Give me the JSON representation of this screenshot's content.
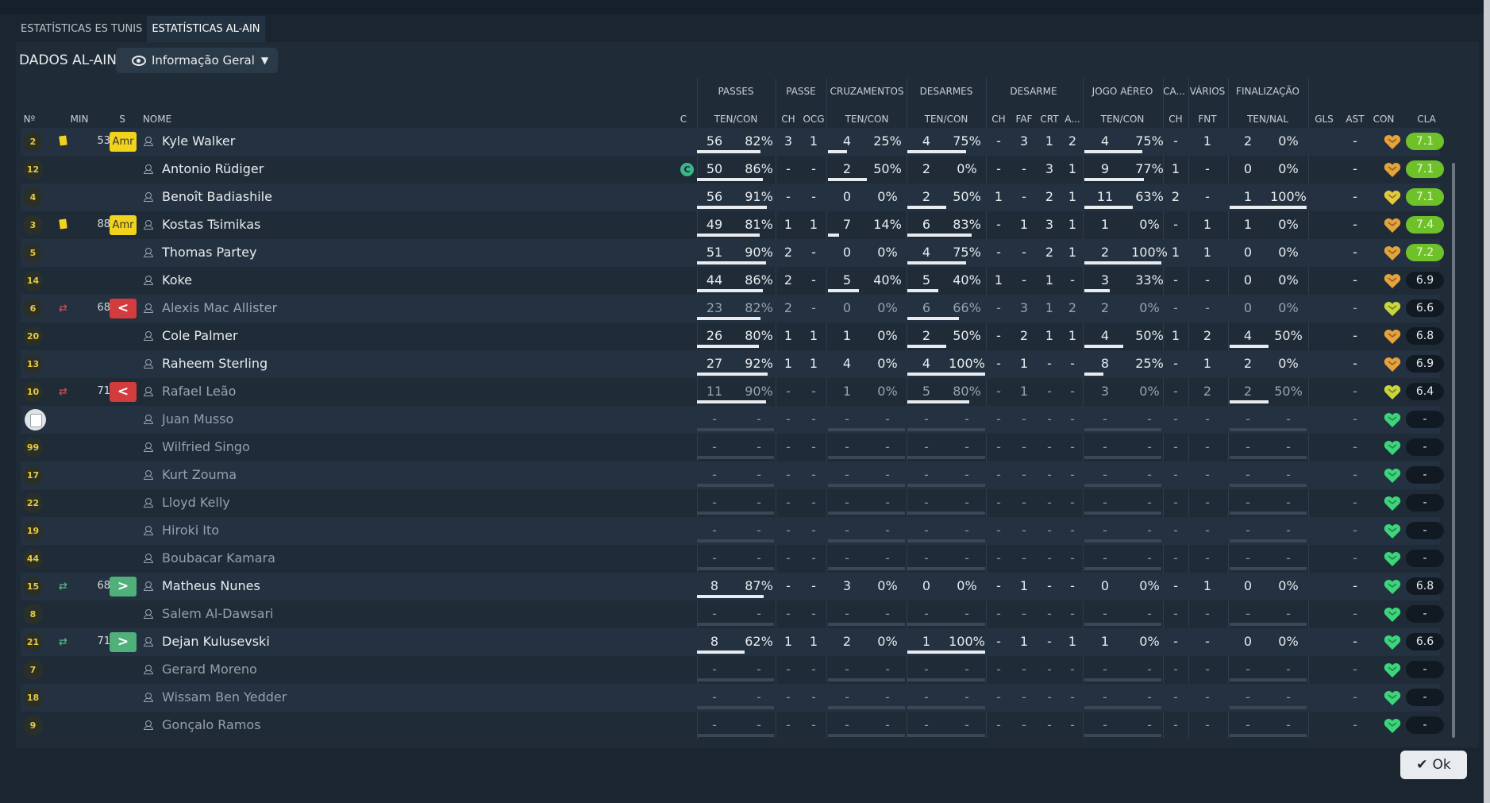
{
  "tabs": [
    "ESTATÍSTICAS ES TUNIS",
    "ESTATÍSTICAS AL-AIN"
  ],
  "active_tab": 1,
  "title": "DADOS AL-AIN",
  "view_select": {
    "label": "Informação Geral",
    "icon": "eye-icon"
  },
  "ok_button": "Ok",
  "group_headers": [
    "PASSES",
    "PASSE",
    "CRUZAMENTOS",
    "DESARMES",
    "DESARME",
    "JOGO AÉREO",
    "CA...",
    "VÁRIOS",
    "FINALIZAÇÃO"
  ],
  "column_headers": [
    "Nº",
    "MIN",
    "S",
    "NOME",
    "C",
    "TEN/CON",
    "CH",
    "OCG",
    "TEN/CON",
    "TEN/CON",
    "CH",
    "FAF",
    "CRT",
    "A...",
    "TEN/CON",
    "CH",
    "FNT",
    "TEN/NAL",
    "GLS",
    "AST",
    "CON",
    "CLA"
  ],
  "colors": {
    "accent_green": "#6fc12a",
    "yellow_card": "#f1d31b",
    "sub_out": "#d23c3c",
    "sub_in": "#4fb07a",
    "heart_green": "#3cd67a"
  },
  "players": [
    {
      "no": "2",
      "card": true,
      "sub": "",
      "min": "53",
      "badge": "Amr",
      "name": "Kyle Walker",
      "captain": false,
      "state": "start",
      "passes": [
        "56",
        "82%"
      ],
      "passes_fill": 0.82,
      "passe": [
        "3",
        "1"
      ],
      "cruz": [
        "4",
        "25%"
      ],
      "cruz_fill": 0.25,
      "desarmes": [
        "4",
        "75%"
      ],
      "desarmes_fill": 0.75,
      "desarme": [
        "-",
        "3",
        "1",
        "2"
      ],
      "aereo": [
        "4",
        "75%"
      ],
      "aereo_fill": 0.75,
      "ca": "-",
      "fnt": "1",
      "final": [
        "2",
        "0%"
      ],
      "final_fill": 0.0,
      "gls": "",
      "ast": "-",
      "heart": "#e8a23a",
      "cla": "7.1",
      "cla_good": true
    },
    {
      "no": "12",
      "card": false,
      "sub": "",
      "min": "",
      "badge": "",
      "name": "Antonio Rüdiger",
      "captain": true,
      "state": "start",
      "passes": [
        "50",
        "86%"
      ],
      "passes_fill": 0.86,
      "passe": [
        "-",
        "-"
      ],
      "cruz": [
        "2",
        "50%"
      ],
      "cruz_fill": 0.5,
      "desarmes": [
        "2",
        "0%"
      ],
      "desarmes_fill": 0.0,
      "desarme": [
        "-",
        "-",
        "3",
        "1"
      ],
      "aereo": [
        "9",
        "77%"
      ],
      "aereo_fill": 0.77,
      "ca": "1",
      "fnt": "-",
      "final": [
        "0",
        "0%"
      ],
      "final_fill": 0.0,
      "gls": "",
      "ast": "-",
      "heart": "#e8a23a",
      "cla": "7.1",
      "cla_good": true
    },
    {
      "no": "4",
      "card": false,
      "sub": "",
      "min": "",
      "badge": "",
      "name": "Benoît Badiashile",
      "captain": false,
      "state": "start",
      "passes": [
        "56",
        "91%"
      ],
      "passes_fill": 0.91,
      "passe": [
        "-",
        "-"
      ],
      "cruz": [
        "0",
        "0%"
      ],
      "cruz_fill": 0.0,
      "desarmes": [
        "2",
        "50%"
      ],
      "desarmes_fill": 0.5,
      "desarme": [
        "1",
        "-",
        "2",
        "1"
      ],
      "aereo": [
        "11",
        "63%"
      ],
      "aereo_fill": 0.63,
      "ca": "2",
      "fnt": "-",
      "final": [
        "1",
        "100%"
      ],
      "final_fill": 1.0,
      "gls": "",
      "ast": "-",
      "heart": "#e6c93a",
      "cla": "7.1",
      "cla_good": true
    },
    {
      "no": "3",
      "card": true,
      "sub": "",
      "min": "88",
      "badge": "Amr",
      "name": "Kostas Tsimikas",
      "captain": false,
      "state": "start",
      "passes": [
        "49",
        "81%"
      ],
      "passes_fill": 0.81,
      "passe": [
        "1",
        "1"
      ],
      "cruz": [
        "7",
        "14%"
      ],
      "cruz_fill": 0.14,
      "desarmes": [
        "6",
        "83%"
      ],
      "desarmes_fill": 0.83,
      "desarme": [
        "-",
        "1",
        "3",
        "1"
      ],
      "aereo": [
        "1",
        "0%"
      ],
      "aereo_fill": 0.0,
      "ca": "-",
      "fnt": "1",
      "final": [
        "1",
        "0%"
      ],
      "final_fill": 0.0,
      "gls": "",
      "ast": "-",
      "heart": "#e8a23a",
      "cla": "7.4",
      "cla_good": true
    },
    {
      "no": "5",
      "card": false,
      "sub": "",
      "min": "",
      "badge": "",
      "name": "Thomas Partey",
      "captain": false,
      "state": "start",
      "passes": [
        "51",
        "90%"
      ],
      "passes_fill": 0.9,
      "passe": [
        "2",
        "-"
      ],
      "cruz": [
        "0",
        "0%"
      ],
      "cruz_fill": 0.0,
      "desarmes": [
        "4",
        "75%"
      ],
      "desarmes_fill": 0.75,
      "desarme": [
        "-",
        "-",
        "2",
        "1"
      ],
      "aereo": [
        "2",
        "100%"
      ],
      "aereo_fill": 1.0,
      "ca": "1",
      "fnt": "1",
      "final": [
        "0",
        "0%"
      ],
      "final_fill": 0.0,
      "gls": "",
      "ast": "-",
      "heart": "#e8a23a",
      "cla": "7.2",
      "cla_good": true
    },
    {
      "no": "14",
      "card": false,
      "sub": "",
      "min": "",
      "badge": "",
      "name": "Koke",
      "captain": false,
      "state": "start",
      "passes": [
        "44",
        "86%"
      ],
      "passes_fill": 0.86,
      "passe": [
        "2",
        "-"
      ],
      "cruz": [
        "5",
        "40%"
      ],
      "cruz_fill": 0.4,
      "desarmes": [
        "5",
        "40%"
      ],
      "desarmes_fill": 0.4,
      "desarme": [
        "1",
        "-",
        "1",
        "-"
      ],
      "aereo": [
        "3",
        "33%"
      ],
      "aereo_fill": 0.33,
      "ca": "-",
      "fnt": "-",
      "final": [
        "0",
        "0%"
      ],
      "final_fill": 0.0,
      "gls": "",
      "ast": "-",
      "heart": "#e8a23a",
      "cla": "6.9",
      "cla_good": false
    },
    {
      "no": "6",
      "card": false,
      "sub": "out",
      "min": "68",
      "badge": "<",
      "name": "Alexis Mac Allister",
      "captain": false,
      "state": "faded",
      "passes": [
        "23",
        "82%"
      ],
      "passes_fill": 0.82,
      "passe": [
        "2",
        "-"
      ],
      "cruz": [
        "0",
        "0%"
      ],
      "cruz_fill": 0.0,
      "desarmes": [
        "6",
        "66%"
      ],
      "desarmes_fill": 0.66,
      "desarme": [
        "-",
        "3",
        "1",
        "2"
      ],
      "aereo": [
        "2",
        "0%"
      ],
      "aereo_fill": 0.0,
      "ca": "-",
      "fnt": "-",
      "final": [
        "0",
        "0%"
      ],
      "final_fill": 0.0,
      "gls": "",
      "ast": "-",
      "heart": "#c9d63a",
      "cla": "6.6",
      "cla_good": false
    },
    {
      "no": "20",
      "card": false,
      "sub": "",
      "min": "",
      "badge": "",
      "name": "Cole Palmer",
      "captain": false,
      "state": "start",
      "passes": [
        "26",
        "80%"
      ],
      "passes_fill": 0.8,
      "passe": [
        "1",
        "1"
      ],
      "cruz": [
        "1",
        "0%"
      ],
      "cruz_fill": 0.0,
      "desarmes": [
        "2",
        "50%"
      ],
      "desarmes_fill": 0.5,
      "desarme": [
        "-",
        "2",
        "1",
        "1"
      ],
      "aereo": [
        "4",
        "50%"
      ],
      "aereo_fill": 0.5,
      "ca": "1",
      "fnt": "2",
      "final": [
        "4",
        "50%"
      ],
      "final_fill": 0.5,
      "gls": "",
      "ast": "-",
      "heart": "#e8a23a",
      "cla": "6.8",
      "cla_good": false
    },
    {
      "no": "13",
      "card": false,
      "sub": "",
      "min": "",
      "badge": "",
      "name": "Raheem Sterling",
      "captain": false,
      "state": "start",
      "passes": [
        "27",
        "92%"
      ],
      "passes_fill": 0.92,
      "passe": [
        "1",
        "1"
      ],
      "cruz": [
        "4",
        "0%"
      ],
      "cruz_fill": 0.0,
      "desarmes": [
        "4",
        "100%"
      ],
      "desarmes_fill": 1.0,
      "desarme": [
        "-",
        "1",
        "-",
        "-"
      ],
      "aereo": [
        "8",
        "25%"
      ],
      "aereo_fill": 0.25,
      "ca": "-",
      "fnt": "1",
      "final": [
        "2",
        "0%"
      ],
      "final_fill": 0.0,
      "gls": "",
      "ast": "-",
      "heart": "#e8a23a",
      "cla": "6.9",
      "cla_good": false
    },
    {
      "no": "10",
      "card": false,
      "sub": "out",
      "min": "71",
      "badge": "<",
      "name": "Rafael Leão",
      "captain": false,
      "state": "faded",
      "passes": [
        "11",
        "90%"
      ],
      "passes_fill": 0.9,
      "passe": [
        "-",
        "-"
      ],
      "cruz": [
        "1",
        "0%"
      ],
      "cruz_fill": 0.0,
      "desarmes": [
        "5",
        "80%"
      ],
      "desarmes_fill": 0.8,
      "desarme": [
        "-",
        "1",
        "-",
        "-"
      ],
      "aereo": [
        "3",
        "0%"
      ],
      "aereo_fill": 0.0,
      "ca": "-",
      "fnt": "2",
      "final": [
        "2",
        "50%"
      ],
      "final_fill": 0.5,
      "gls": "",
      "ast": "-",
      "heart": "#c9d63a",
      "cla": "6.4",
      "cla_good": false
    },
    {
      "no": "",
      "card": false,
      "sub": "",
      "min": "",
      "badge": "",
      "name": "Juan Musso",
      "captain": false,
      "state": "bench",
      "gk": true
    },
    {
      "no": "99",
      "card": false,
      "sub": "",
      "min": "",
      "badge": "",
      "name": "Wilfried Singo",
      "captain": false,
      "state": "bench"
    },
    {
      "no": "17",
      "card": false,
      "sub": "",
      "min": "",
      "badge": "",
      "name": "Kurt Zouma",
      "captain": false,
      "state": "bench"
    },
    {
      "no": "22",
      "card": false,
      "sub": "",
      "min": "",
      "badge": "",
      "name": "Lloyd Kelly",
      "captain": false,
      "state": "bench"
    },
    {
      "no": "19",
      "card": false,
      "sub": "",
      "min": "",
      "badge": "",
      "name": "Hiroki Ito",
      "captain": false,
      "state": "bench"
    },
    {
      "no": "44",
      "card": false,
      "sub": "",
      "min": "",
      "badge": "",
      "name": "Boubacar Kamara",
      "captain": false,
      "state": "bench"
    },
    {
      "no": "15",
      "card": false,
      "sub": "in",
      "min": "68",
      "badge": ">",
      "name": "Matheus Nunes",
      "captain": false,
      "state": "start",
      "passes": [
        "8",
        "87%"
      ],
      "passes_fill": 0.87,
      "passe": [
        "-",
        "-"
      ],
      "cruz": [
        "3",
        "0%"
      ],
      "cruz_fill": 0.0,
      "desarmes": [
        "0",
        "0%"
      ],
      "desarmes_fill": 0.0,
      "desarme": [
        "-",
        "1",
        "-",
        "-"
      ],
      "aereo": [
        "0",
        "0%"
      ],
      "aereo_fill": 0.0,
      "ca": "-",
      "fnt": "1",
      "final": [
        "0",
        "0%"
      ],
      "final_fill": 0.0,
      "gls": "",
      "ast": "-",
      "heart": "#3cd67a",
      "cla": "6.8",
      "cla_good": false
    },
    {
      "no": "8",
      "card": false,
      "sub": "",
      "min": "",
      "badge": "",
      "name": "Salem Al-Dawsari",
      "captain": false,
      "state": "bench"
    },
    {
      "no": "21",
      "card": false,
      "sub": "in",
      "min": "71",
      "badge": ">",
      "name": "Dejan Kulusevski",
      "captain": false,
      "state": "start",
      "passes": [
        "8",
        "62%"
      ],
      "passes_fill": 0.62,
      "passe": [
        "1",
        "1"
      ],
      "cruz": [
        "2",
        "0%"
      ],
      "cruz_fill": 0.0,
      "desarmes": [
        "1",
        "100%"
      ],
      "desarmes_fill": 1.0,
      "desarme": [
        "-",
        "1",
        "-",
        "1"
      ],
      "aereo": [
        "1",
        "0%"
      ],
      "aereo_fill": 0.0,
      "ca": "-",
      "fnt": "-",
      "final": [
        "0",
        "0%"
      ],
      "final_fill": 0.0,
      "gls": "",
      "ast": "-",
      "heart": "#3cd67a",
      "cla": "6.6",
      "cla_good": false
    },
    {
      "no": "7",
      "card": false,
      "sub": "",
      "min": "",
      "badge": "",
      "name": "Gerard Moreno",
      "captain": false,
      "state": "bench"
    },
    {
      "no": "18",
      "card": false,
      "sub": "",
      "min": "",
      "badge": "",
      "name": "Wissam Ben Yedder",
      "captain": false,
      "state": "bench"
    },
    {
      "no": "9",
      "card": false,
      "sub": "",
      "min": "",
      "badge": "",
      "name": "Gonçalo Ramos",
      "captain": false,
      "state": "bench"
    }
  ]
}
